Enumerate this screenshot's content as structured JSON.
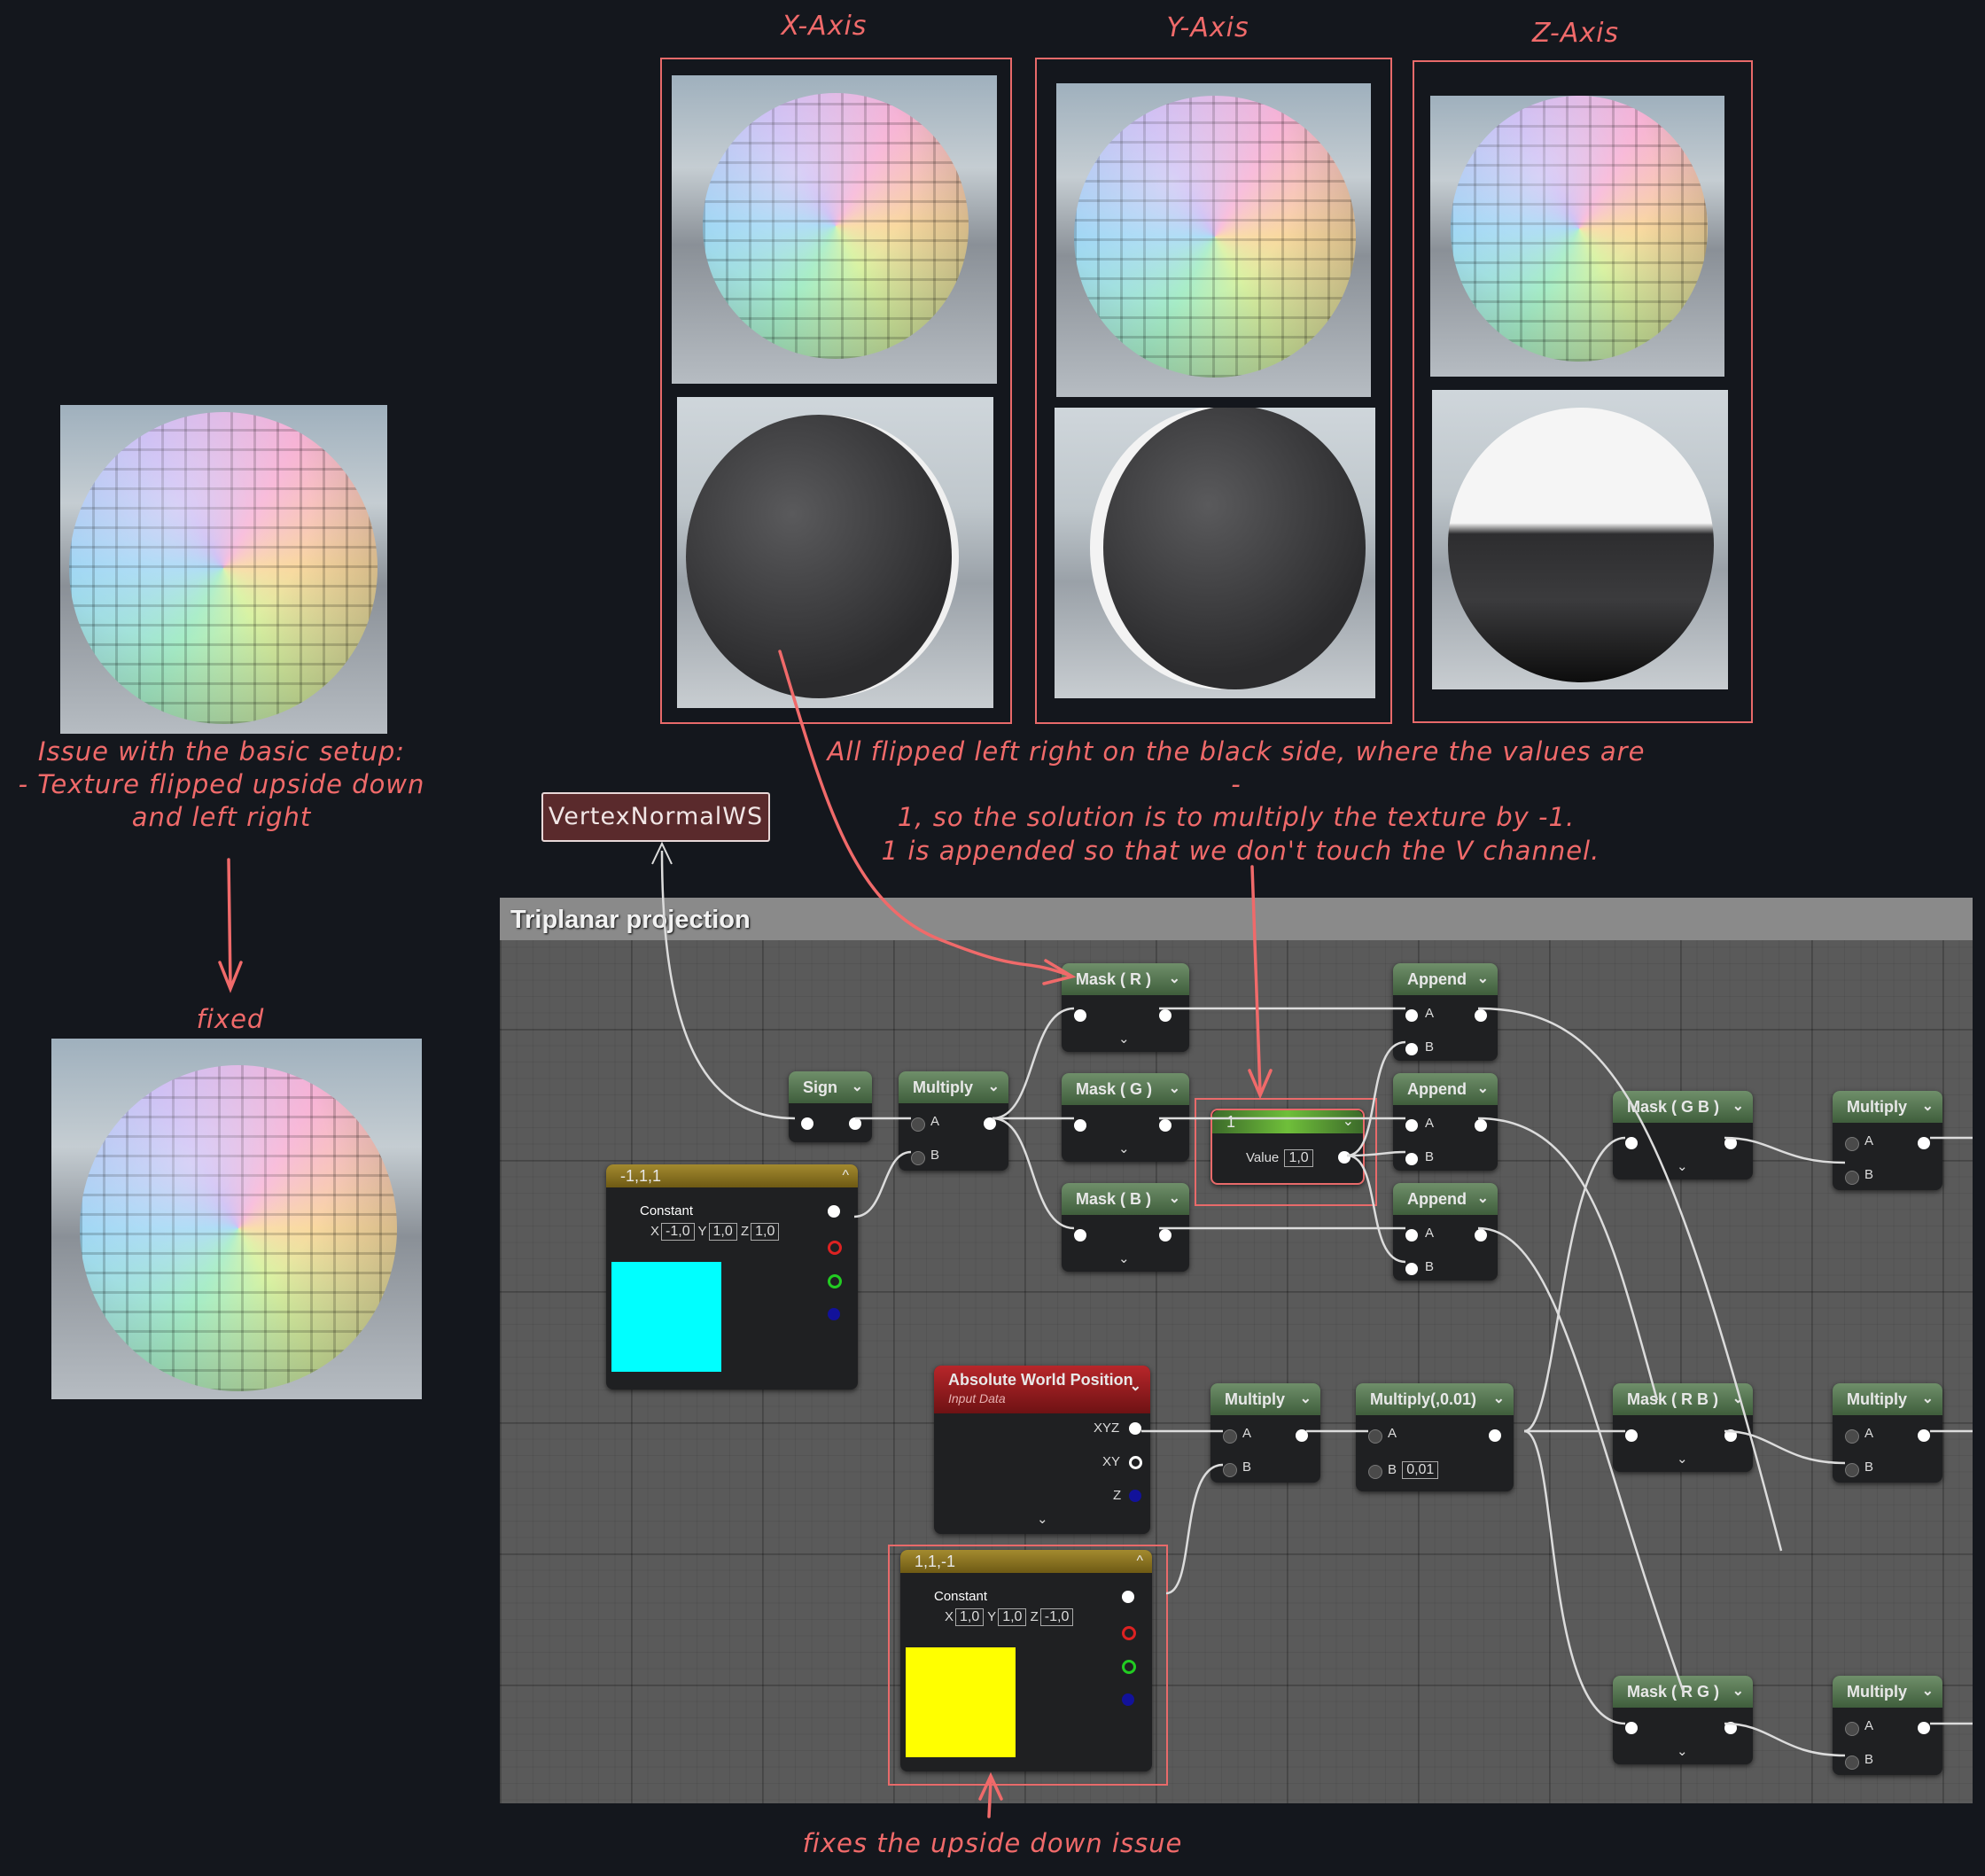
{
  "axes": {
    "x": "X-Axis",
    "y": "Y-Axis",
    "z": "Z-Axis"
  },
  "notes": {
    "issue": [
      "Issue with the basic setup:",
      "- Texture flipped upside down",
      "and left right"
    ],
    "fixed": "fixed",
    "flipped": [
      "All flipped left right on the black side, where the values are -",
      "1, so the solution is to multiply the texture by -1."
    ],
    "appended": "1 is appended so that we don't touch the V channel.",
    "fixes_upside": "fixes the upside down issue",
    "vertex_tag": "VertexNormalWS"
  },
  "graph": {
    "title": "Triplanar projection",
    "nodes": {
      "sign": "Sign",
      "multiply": "Multiply",
      "mask_r": "Mask ( R )",
      "mask_g": "Mask ( G )",
      "mask_b": "Mask ( B )",
      "append": "Append",
      "one": {
        "title": "1",
        "label": "Value",
        "value": "1,0"
      },
      "const1": {
        "title": "-1,1,1",
        "label": "Constant",
        "x": "-1,0",
        "y": "1,0",
        "z": "1,0",
        "color": "#00ffff"
      },
      "const2": {
        "title": "1,1,-1",
        "label": "Constant",
        "x": "1,0",
        "y": "1,0",
        "z": "-1,0",
        "color": "#ffff00"
      },
      "awp": {
        "title": "Absolute World Position",
        "subtitle": "Input Data",
        "xyz": "XYZ",
        "xy": "XY",
        "z": "Z"
      },
      "mult001": {
        "title": "Multiply(,0.01)",
        "b": "0,01"
      },
      "mask_gb": "Mask ( G B )",
      "mask_rb": "Mask ( R B )",
      "mask_rg": "Mask ( R G )",
      "pin_a": "A",
      "pin_b": "B",
      "axis_x": "X",
      "axis_y": "Y",
      "axis_z": "Z"
    }
  }
}
